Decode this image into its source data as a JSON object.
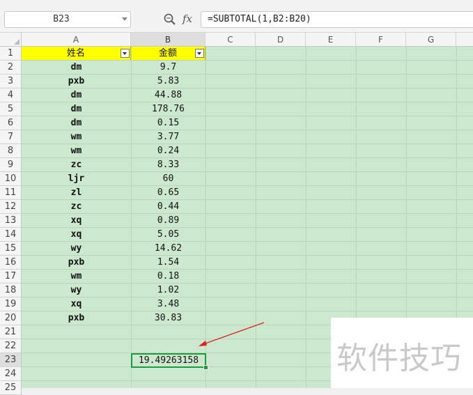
{
  "formula_bar": {
    "name_box": "B23",
    "fx_label": "fx",
    "formula": "=SUBTOTAL(1,B2:B20)"
  },
  "columns": [
    "A",
    "B",
    "C",
    "D",
    "E",
    "F",
    "G"
  ],
  "header": {
    "name": "姓名",
    "amount": "金额"
  },
  "rows": [
    {
      "name": "dm",
      "amount": "9.7"
    },
    {
      "name": "pxb",
      "amount": "5.83"
    },
    {
      "name": "dm",
      "amount": "44.88"
    },
    {
      "name": "dm",
      "amount": "178.76"
    },
    {
      "name": "dm",
      "amount": "0.15"
    },
    {
      "name": "wm",
      "amount": "3.77"
    },
    {
      "name": "wm",
      "amount": "0.24"
    },
    {
      "name": "zc",
      "amount": "8.33"
    },
    {
      "name": "ljr",
      "amount": "60"
    },
    {
      "name": "zl",
      "amount": "0.65"
    },
    {
      "name": "zc",
      "amount": "0.44"
    },
    {
      "name": "xq",
      "amount": "0.89"
    },
    {
      "name": "xq",
      "amount": "5.05"
    },
    {
      "name": "wy",
      "amount": "14.62"
    },
    {
      "name": "pxb",
      "amount": "1.54"
    },
    {
      "name": "wm",
      "amount": "0.18"
    },
    {
      "name": "wy",
      "amount": "1.02"
    },
    {
      "name": "xq",
      "amount": "3.48"
    },
    {
      "name": "pxb",
      "amount": "30.83"
    }
  ],
  "row_numbers": [
    "1",
    "2",
    "3",
    "4",
    "5",
    "6",
    "7",
    "8",
    "9",
    "10",
    "11",
    "12",
    "13",
    "14",
    "15",
    "16",
    "17",
    "18",
    "19",
    "20",
    "21",
    "22",
    "23",
    "24",
    "25"
  ],
  "result": {
    "value": "19.49263158"
  },
  "watermark": "软件技巧",
  "colors": {
    "sheet_bg": "#cce8cf",
    "header_fill": "#ffff00",
    "selection": "#1e9b3c",
    "arrow": "#e02020"
  }
}
